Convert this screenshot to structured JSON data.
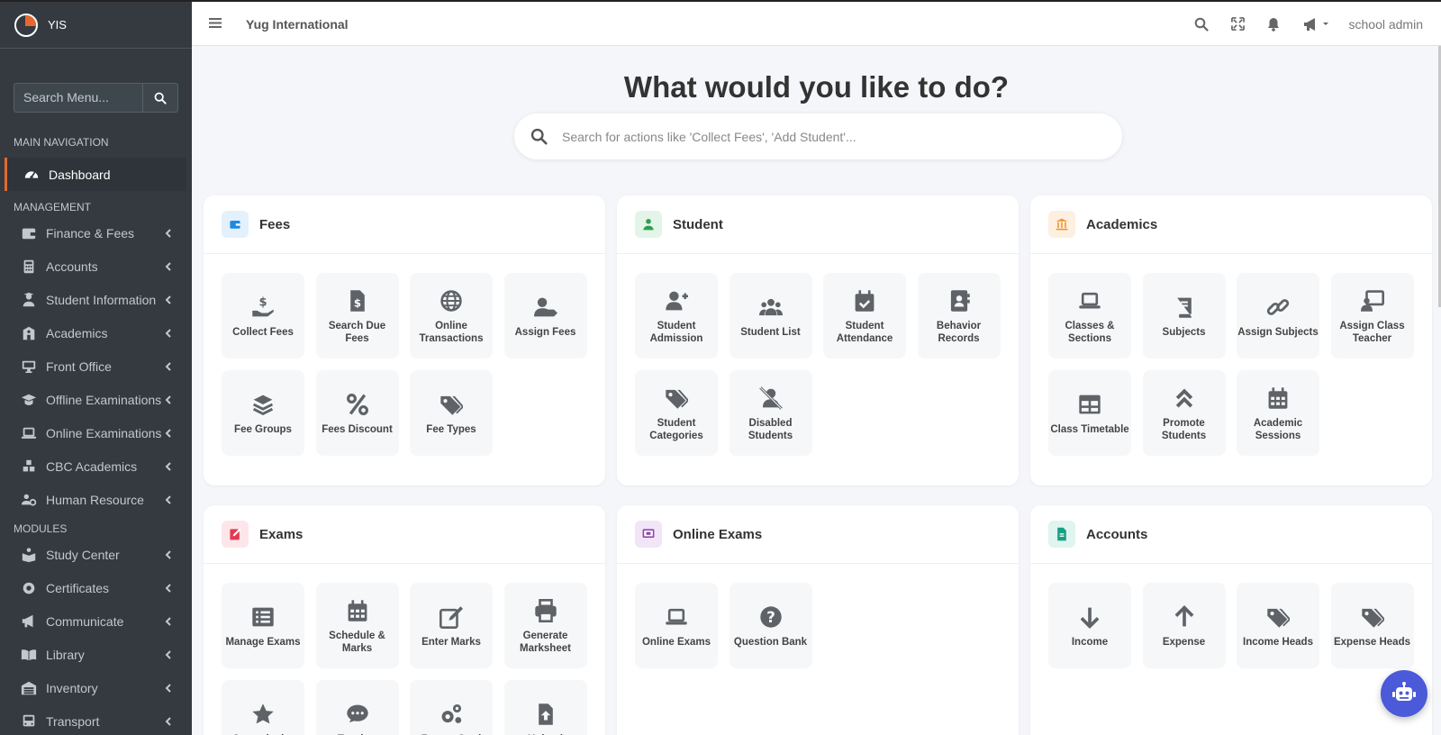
{
  "brand": {
    "name": "YIS"
  },
  "sidebar": {
    "search_placeholder": "Search Menu...",
    "main_header": "MAIN NAVIGATION",
    "dashboard": "Dashboard",
    "management_header": "MANAGEMENT",
    "management": [
      {
        "label": "Finance & Fees",
        "icon": "wallet-icon"
      },
      {
        "label": "Accounts",
        "icon": "calculator-icon"
      },
      {
        "label": "Student Information",
        "icon": "user-graduate-icon"
      },
      {
        "label": "Academics",
        "icon": "school-icon"
      },
      {
        "label": "Front Office",
        "icon": "desktop-icon"
      },
      {
        "label": "Offline Examinations",
        "icon": "graduation-cap-icon"
      },
      {
        "label": "Online Examinations",
        "icon": "laptop-icon"
      },
      {
        "label": "CBC Academics",
        "icon": "cubes-icon"
      },
      {
        "label": "Human Resource",
        "icon": "users-cog-icon"
      }
    ],
    "modules_header": "MODULES",
    "modules": [
      {
        "label": "Study Center",
        "icon": "book-reader-icon"
      },
      {
        "label": "Certificates",
        "icon": "certificate-icon"
      },
      {
        "label": "Communicate",
        "icon": "bullhorn-icon"
      },
      {
        "label": "Library",
        "icon": "book-open-icon"
      },
      {
        "label": "Inventory",
        "icon": "warehouse-icon"
      },
      {
        "label": "Transport",
        "icon": "bus-icon"
      }
    ]
  },
  "topbar": {
    "school": "Yug International",
    "user": "school admin"
  },
  "hero": {
    "title": "What would you like to do?",
    "search_placeholder": "Search for actions like 'Collect Fees', 'Add Student'..."
  },
  "cards": [
    {
      "title": "Fees",
      "accent": "#1e88e5",
      "tint": "#e3f1fc",
      "tiles": [
        {
          "label": "Collect Fees",
          "icon": "hand-dollar-icon"
        },
        {
          "label": "Search Due Fees",
          "icon": "file-dollar-icon"
        },
        {
          "label": "Online Transactions",
          "icon": "globe-icon"
        },
        {
          "label": "Assign Fees",
          "icon": "user-tag-icon"
        },
        {
          "label": "Fee Groups",
          "icon": "layer-group-icon"
        },
        {
          "label": "Fees Discount",
          "icon": "percent-icon"
        },
        {
          "label": "Fee Types",
          "icon": "tags-icon"
        }
      ]
    },
    {
      "title": "Student",
      "accent": "#2e9e4f",
      "tint": "#e3f5e8",
      "tiles": [
        {
          "label": "Student Admission",
          "icon": "user-plus-icon"
        },
        {
          "label": "Student List",
          "icon": "users-icon"
        },
        {
          "label": "Student Attendance",
          "icon": "calendar-check-icon"
        },
        {
          "label": "Behavior Records",
          "icon": "address-book-icon"
        },
        {
          "label": "Student Categories",
          "icon": "tags-icon"
        },
        {
          "label": "Disabled Students",
          "icon": "user-slash-icon"
        }
      ]
    },
    {
      "title": "Academics",
      "accent": "#f0932b",
      "tint": "#fdf0e0",
      "tiles": [
        {
          "label": "Classes & Sections",
          "icon": "laptop-icon"
        },
        {
          "label": "Subjects",
          "icon": "book-icon"
        },
        {
          "label": "Assign Subjects",
          "icon": "link-icon"
        },
        {
          "label": "Assign Class Teacher",
          "icon": "chalkboard-teacher-icon"
        },
        {
          "label": "Class Timetable",
          "icon": "table-icon"
        },
        {
          "label": "Promote Students",
          "icon": "angle-double-up-icon"
        },
        {
          "label": "Academic Sessions",
          "icon": "calendar-icon"
        }
      ]
    },
    {
      "title": "Exams",
      "accent": "#e53950",
      "tint": "#fde6ea",
      "tiles": [
        {
          "label": "Manage Exams",
          "icon": "list-alt-icon"
        },
        {
          "label": "Schedule & Marks",
          "icon": "calendar-alt-icon"
        },
        {
          "label": "Enter Marks",
          "icon": "edit-icon"
        },
        {
          "label": "Generate Marksheet",
          "icon": "print-icon"
        },
        {
          "label": "Cocurricular",
          "icon": "star-icon"
        },
        {
          "label": "Teacher",
          "icon": "comment-icon"
        },
        {
          "label": "Report Card",
          "icon": "cogs-icon"
        },
        {
          "label": "Upload",
          "icon": "file-upload-icon"
        }
      ]
    },
    {
      "title": "Online Exams",
      "accent": "#8e44ad",
      "tint": "#f1e5f7",
      "tiles": [
        {
          "label": "Online Exams",
          "icon": "laptop-icon"
        },
        {
          "label": "Question Bank",
          "icon": "question-circle-icon"
        }
      ]
    },
    {
      "title": "Accounts",
      "accent": "#16a085",
      "tint": "#e0f4f0",
      "tiles": [
        {
          "label": "Income",
          "icon": "arrow-down-icon"
        },
        {
          "label": "Expense",
          "icon": "arrow-up-icon"
        },
        {
          "label": "Income Heads",
          "icon": "tags-icon"
        },
        {
          "label": "Expense Heads",
          "icon": "tags-icon"
        }
      ]
    }
  ]
}
